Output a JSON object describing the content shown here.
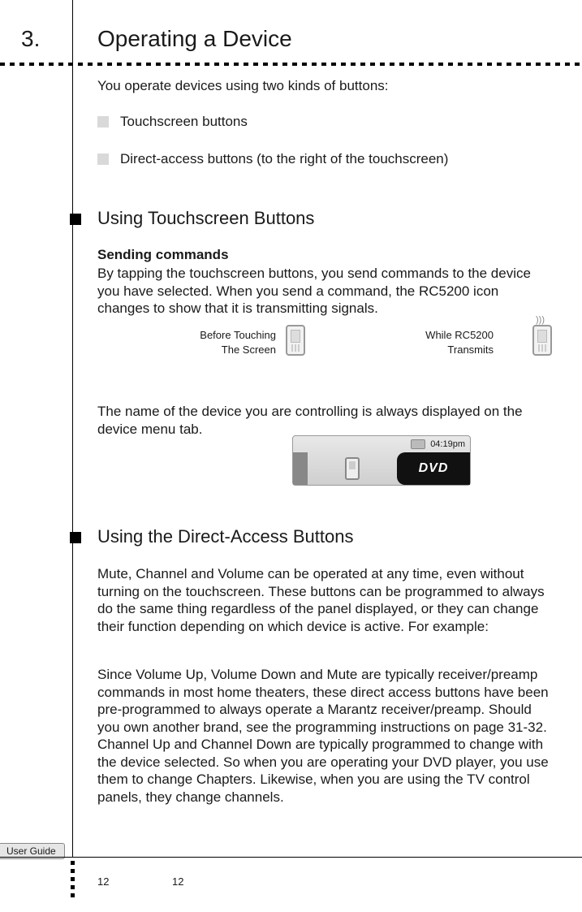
{
  "chapter": {
    "num": "3.",
    "title": "Operating a Device"
  },
  "intro": "You operate devices using two kinds of buttons:",
  "bullets": {
    "b1": "Touchscreen buttons",
    "b2": "Direct-access buttons (to the right of the touchscreen)"
  },
  "sections": {
    "s1": "Using Touchscreen Buttons",
    "s2": "Using the Direct-Access Buttons"
  },
  "subhead1": "Sending commands",
  "para1": "By tapping the touchscreen buttons, you send commands to the device you have selected. When you send a command, the RC5200 icon changes to show that it is transmitting signals.",
  "captions": {
    "c1a": "Before Touching",
    "c1b": "The Screen",
    "c2a": "While RC5200",
    "c2b": "Transmits"
  },
  "para2": "The name of the device you are controlling is always displayed on the device menu tab.",
  "menutab": {
    "time": "04:19pm",
    "device": "DVD"
  },
  "para3": "Mute, Channel and Volume can be operated at any time, even without turning on the touchscreen. These buttons can be programmed to always do the same thing regardless of the panel displayed, or they can change their function depending on which device is active. For example:",
  "para4": "Since Volume Up, Volume Down and Mute are typically receiver/preamp commands in most home theaters, these direct access buttons have been pre-programmed to always operate a Marantz receiver/preamp. Should you own another brand, see the programming instructions on page 31-32. Channel Up and Channel Down are typically programmed to change with the device selected. So when you are operating your DVD player, you use them to change Chapters. Likewise, when you are using the TV control panels, they change channels.",
  "footer": {
    "tab": "User Guide",
    "page1": "12",
    "page2": "12"
  }
}
